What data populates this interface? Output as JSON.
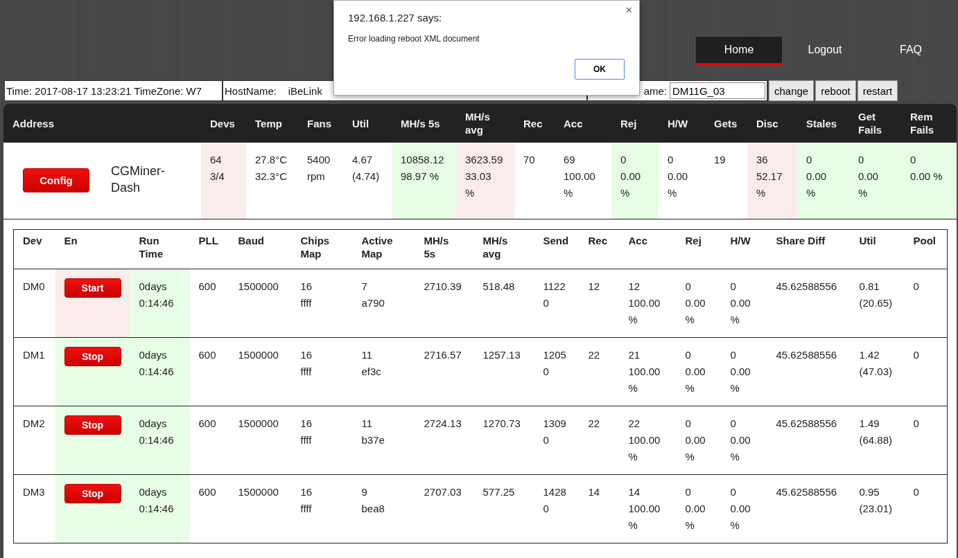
{
  "nav": [
    {
      "label": "Home",
      "selected": true
    },
    {
      "label": "Logout",
      "selected": false
    },
    {
      "label": "FAQ",
      "selected": false
    }
  ],
  "info_bar": {
    "time": "Time: 2017-08-17 13:23:21 TimeZone: W7",
    "hostname": "HostName:    iBeLink",
    "new_hostname_label": "ame:",
    "new_hostname_value": "DM11G_03",
    "buttons": [
      "change",
      "reboot",
      "restart"
    ]
  },
  "summary": {
    "columns": [
      "Address",
      "Devs",
      "Temp",
      "Fans",
      "Util",
      "MH/s 5s",
      "MH/s\navg",
      "Rec",
      "Acc",
      "Rej",
      "H/W",
      "Gets",
      "Disc",
      "Stales",
      "Get\nFails",
      "Rem\nFails"
    ],
    "cells": [
      {
        "kind": "button",
        "text": "Config"
      },
      {
        "kind": "name",
        "text": "CGMiner-\nDash"
      },
      {
        "text": "64\n3/4",
        "color": "#fbecec"
      },
      {
        "text": "27.8°C\n32.3°C"
      },
      {
        "text": "5400\nrpm"
      },
      {
        "text": "4.67\n(4.74)"
      },
      {
        "text": "10858.12\n98.97 %",
        "color": "#e8fde6"
      },
      {
        "text": "3623.59\n33.03\n%",
        "color": "#fbecec"
      },
      {
        "text": "70"
      },
      {
        "text": "69\n100.00\n%"
      },
      {
        "text": "0\n0.00\n%",
        "color": "#e8fde6"
      },
      {
        "text": "0\n0.00\n%"
      },
      {
        "text": "19"
      },
      {
        "text": "36\n52.17\n%",
        "color": "#fbecec"
      },
      {
        "text": "0\n0.00\n%",
        "color": "#e8fde6"
      },
      {
        "text": "0\n0.00\n%",
        "color": "#e8fde6"
      },
      {
        "text": "0\n0.00 %",
        "color": "#e8fde6"
      }
    ]
  },
  "devices": {
    "columns": [
      "Dev",
      "En",
      "Run\nTime",
      "PLL",
      "Baud",
      "Chips\nMap",
      "Active\nMap",
      "MH/s\n5s",
      "MH/s\navg",
      "Send",
      "Rec",
      "Acc",
      "Rej",
      "H/W",
      "Share Diff",
      "Util",
      "Pool"
    ],
    "rows": [
      {
        "cells": [
          {
            "text": "DM0"
          },
          {
            "kind": "button",
            "text": "Start",
            "color": "#fbecec"
          },
          {
            "text": "0days\n0:14:46",
            "color": "#e8fde6"
          },
          {
            "text": "600"
          },
          {
            "text": "1500000"
          },
          {
            "text": "16\nffff"
          },
          {
            "text": "7\na790"
          },
          {
            "text": "2710.39"
          },
          {
            "text": "518.48"
          },
          {
            "text": "1122\n0"
          },
          {
            "text": "12"
          },
          {
            "text": "12\n100.00\n%"
          },
          {
            "text": "0\n0.00\n%"
          },
          {
            "text": "0\n0.00\n%"
          },
          {
            "text": "45.62588556"
          },
          {
            "text": "0.81\n(20.65)"
          },
          {
            "text": "0"
          }
        ]
      },
      {
        "cells": [
          {
            "text": "DM1"
          },
          {
            "kind": "button",
            "text": "Stop",
            "color": "#e8fde6"
          },
          {
            "text": "0days\n0:14:46",
            "color": "#e8fde6"
          },
          {
            "text": "600"
          },
          {
            "text": "1500000"
          },
          {
            "text": "16\nffff"
          },
          {
            "text": "11\nef3c"
          },
          {
            "text": "2716.57"
          },
          {
            "text": "1257.13"
          },
          {
            "text": "1205\n0"
          },
          {
            "text": "22"
          },
          {
            "text": "21\n100.00\n%"
          },
          {
            "text": "0\n0.00\n%"
          },
          {
            "text": "0\n0.00\n%"
          },
          {
            "text": "45.62588556"
          },
          {
            "text": "1.42\n(47.03)"
          },
          {
            "text": "0"
          }
        ]
      },
      {
        "cells": [
          {
            "text": "DM2"
          },
          {
            "kind": "button",
            "text": "Stop",
            "color": "#e8fde6"
          },
          {
            "text": "0days\n0:14:46",
            "color": "#e8fde6"
          },
          {
            "text": "600"
          },
          {
            "text": "1500000"
          },
          {
            "text": "16\nffff"
          },
          {
            "text": "11\nb37e"
          },
          {
            "text": "2724.13"
          },
          {
            "text": "1270.73"
          },
          {
            "text": "1309\n0"
          },
          {
            "text": "22"
          },
          {
            "text": "22\n100.00\n%"
          },
          {
            "text": "0\n0.00\n%"
          },
          {
            "text": "0\n0.00\n%"
          },
          {
            "text": "45.62588556"
          },
          {
            "text": "1.49\n(64.88)"
          },
          {
            "text": "0"
          }
        ]
      },
      {
        "cells": [
          {
            "text": "DM3"
          },
          {
            "kind": "button",
            "text": "Stop",
            "color": "#e8fde6"
          },
          {
            "text": "0days\n0:14:46",
            "color": "#e8fde6"
          },
          {
            "text": "600"
          },
          {
            "text": "1500000"
          },
          {
            "text": "16\nffff"
          },
          {
            "text": "9\nbea8"
          },
          {
            "text": "2707.03"
          },
          {
            "text": "577.25"
          },
          {
            "text": "1428\n0"
          },
          {
            "text": "14"
          },
          {
            "text": "14\n100.00\n%"
          },
          {
            "text": "0\n0.00\n%"
          },
          {
            "text": "0\n0.00\n%"
          },
          {
            "text": "45.62588556"
          },
          {
            "text": "0.95\n(23.01)"
          },
          {
            "text": "0"
          }
        ]
      }
    ]
  },
  "dialog": {
    "title": "192.168.1.227 says:",
    "message": "Error loading reboot XML document",
    "button": "OK",
    "close": "×"
  }
}
